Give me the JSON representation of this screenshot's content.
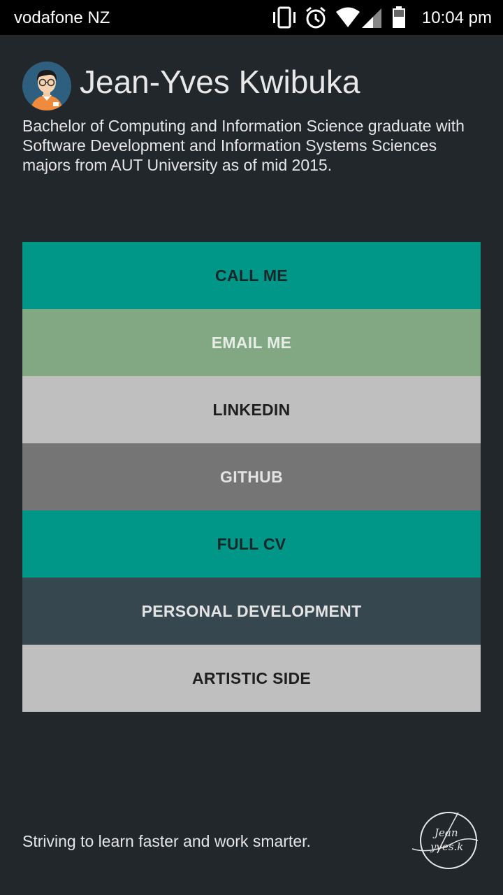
{
  "status_bar": {
    "carrier": "vodafone NZ",
    "time": "10:04 pm",
    "icons": [
      "vibrate-icon",
      "alarm-icon",
      "wifi-icon",
      "signal-icon",
      "battery-icon"
    ]
  },
  "profile": {
    "name": "Jean-Yves Kwibuka",
    "bio": "Bachelor of Computing and Information Science graduate with Software Development and Information Systems Sciences majors from AUT University as of mid 2015."
  },
  "menu": {
    "buttons": [
      {
        "label": "CALL ME",
        "color": "#009688"
      },
      {
        "label": "EMAIL ME",
        "color": "#81a882"
      },
      {
        "label": "LINKEDIN",
        "color": "#bfbfbf"
      },
      {
        "label": "GITHUB",
        "color": "#757575"
      },
      {
        "label": "FULL CV",
        "color": "#009688"
      },
      {
        "label": "PERSONAL DEVELOPMENT",
        "color": "#37474f"
      },
      {
        "label": "ARTISTIC SIDE",
        "color": "#bfbfbf"
      }
    ]
  },
  "footer": {
    "tagline": "Striving to learn faster and work smarter.",
    "signature_text": "Jean Yves.k"
  },
  "colors": {
    "background": "#22272c",
    "status_bar": "#000000"
  }
}
